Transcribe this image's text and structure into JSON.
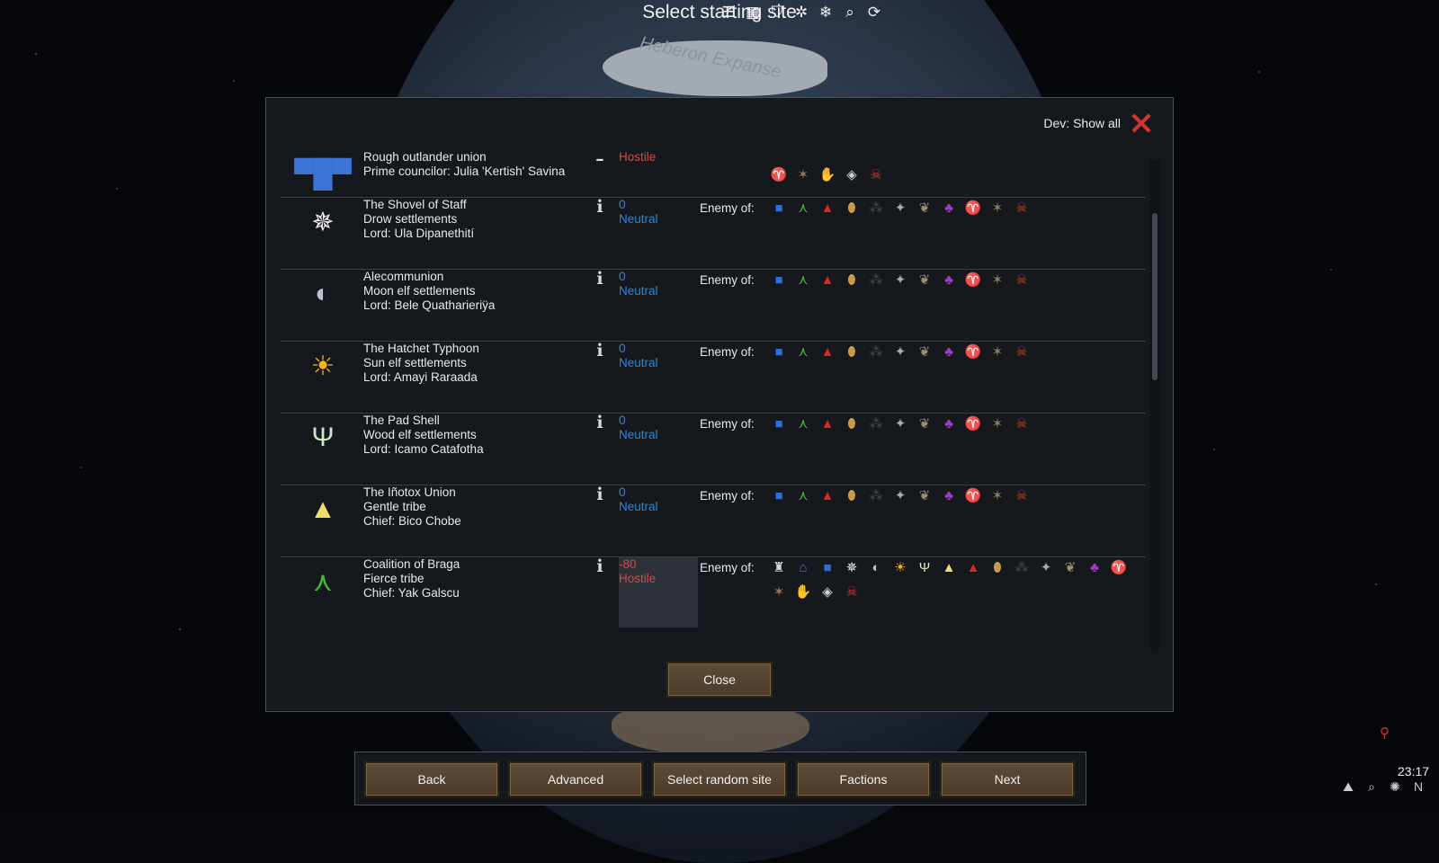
{
  "title": {
    "text": "Select starting site"
  },
  "top_icons": [
    {
      "name": "list-icon",
      "glyph": "☰"
    },
    {
      "name": "table-icon",
      "glyph": "▦"
    },
    {
      "name": "shield-icon",
      "glyph": "⛉"
    },
    {
      "name": "sparkle-icon",
      "glyph": "✲"
    },
    {
      "name": "snowflake-icon",
      "glyph": "❄"
    },
    {
      "name": "search-icon",
      "glyph": "⌕"
    },
    {
      "name": "refresh-icon",
      "glyph": "⟳"
    }
  ],
  "map": {
    "region_label": "Heberon Expanse"
  },
  "dialog": {
    "dev_label": "Dev: Show all",
    "close_label": "Close",
    "enemy_label": "Enemy of:",
    "factions": [
      {
        "name": "Rough outlander union",
        "type": "",
        "leader": "Prime councilor: Julia 'Kertish' Savina",
        "goodwill": "",
        "relation": "Hostile",
        "relation_kind": "hostile",
        "icon": {
          "glyph": "▀█▀",
          "color": "#3b73d6",
          "name": "outlander-union-icon"
        },
        "info": "–",
        "enemies": [
          {
            "glyph": "♈",
            "color": "#c8323a",
            "name": "demon-icon"
          },
          {
            "glyph": "✶",
            "color": "#8a7a5a",
            "name": "crossbones-icon"
          },
          {
            "glyph": "✋",
            "color": "#c97a30",
            "name": "claw-icon"
          },
          {
            "glyph": "◈",
            "color": "#cfcfcf",
            "name": "diamond-icon"
          },
          {
            "glyph": "☠",
            "color": "#d03a2e",
            "name": "pirate-icon"
          }
        ]
      },
      {
        "name": "The Shovel of Staff",
        "type": "Drow settlements",
        "leader": "Lord: Ula Dipanethití",
        "goodwill": "0",
        "relation": "Neutral",
        "relation_kind": "neutral",
        "icon": {
          "glyph": "✵",
          "color": "#f0f0f0",
          "name": "drow-star-icon"
        },
        "info": "i",
        "enemies": [
          {
            "glyph": "■",
            "color": "#2f6fd0",
            "name": "blue-banner-icon"
          },
          {
            "glyph": "⋏",
            "color": "#3fbf3a",
            "name": "green-tribe-icon"
          },
          {
            "glyph": "▲",
            "color": "#d52a22",
            "name": "red-tribe-icon"
          },
          {
            "glyph": "⬮",
            "color": "#c89a4a",
            "name": "beetle-icon"
          },
          {
            "glyph": "⁂",
            "color": "#4a4a4a",
            "name": "spider-icon"
          },
          {
            "glyph": "✦",
            "color": "#b0a89a",
            "name": "wings-icon"
          },
          {
            "glyph": "❦",
            "color": "#a08c6e",
            "name": "bull-icon"
          },
          {
            "glyph": "♣",
            "color": "#a33ad0",
            "name": "purple-faction-icon"
          },
          {
            "glyph": "♈",
            "color": "#c8323a",
            "name": "demon-icon"
          },
          {
            "glyph": "✶",
            "color": "#8a7a5a",
            "name": "crossbones-icon"
          },
          {
            "glyph": "☠",
            "color": "#d03a2e",
            "name": "pirate-icon"
          }
        ]
      },
      {
        "name": "Alecommunion",
        "type": "Moon elf settlements",
        "leader": "Lord: Bele Quatharieriÿa",
        "goodwill": "0",
        "relation": "Neutral",
        "relation_kind": "neutral",
        "icon": {
          "glyph": "◐",
          "color": "#b8c4cf",
          "name": "moon-icon"
        },
        "info": "i",
        "enemies": [
          {
            "glyph": "■",
            "color": "#2f6fd0",
            "name": "blue-banner-icon"
          },
          {
            "glyph": "⋏",
            "color": "#3fbf3a",
            "name": "green-tribe-icon"
          },
          {
            "glyph": "▲",
            "color": "#d52a22",
            "name": "red-tribe-icon"
          },
          {
            "glyph": "⬮",
            "color": "#c89a4a",
            "name": "beetle-icon"
          },
          {
            "glyph": "⁂",
            "color": "#4a4a4a",
            "name": "spider-icon"
          },
          {
            "glyph": "✦",
            "color": "#b0a89a",
            "name": "wings-icon"
          },
          {
            "glyph": "❦",
            "color": "#a08c6e",
            "name": "bull-icon"
          },
          {
            "glyph": "♣",
            "color": "#a33ad0",
            "name": "purple-faction-icon"
          },
          {
            "glyph": "♈",
            "color": "#c8323a",
            "name": "demon-icon"
          },
          {
            "glyph": "✶",
            "color": "#8a7a5a",
            "name": "crossbones-icon"
          },
          {
            "glyph": "☠",
            "color": "#d03a2e",
            "name": "pirate-icon"
          }
        ]
      },
      {
        "name": "The Hatchet Typhoon",
        "type": "Sun elf settlements",
        "leader": "Lord: Amayi Raraada",
        "goodwill": "0",
        "relation": "Neutral",
        "relation_kind": "neutral",
        "icon": {
          "glyph": "☀",
          "color": "#f5b321",
          "name": "sun-icon"
        },
        "info": "i",
        "enemies": [
          {
            "glyph": "■",
            "color": "#2f6fd0",
            "name": "blue-banner-icon"
          },
          {
            "glyph": "⋏",
            "color": "#3fbf3a",
            "name": "green-tribe-icon"
          },
          {
            "glyph": "▲",
            "color": "#d52a22",
            "name": "red-tribe-icon"
          },
          {
            "glyph": "⬮",
            "color": "#c89a4a",
            "name": "beetle-icon"
          },
          {
            "glyph": "⁂",
            "color": "#4a4a4a",
            "name": "spider-icon"
          },
          {
            "glyph": "✦",
            "color": "#b0a89a",
            "name": "wings-icon"
          },
          {
            "glyph": "❦",
            "color": "#a08c6e",
            "name": "bull-icon"
          },
          {
            "glyph": "♣",
            "color": "#a33ad0",
            "name": "purple-faction-icon"
          },
          {
            "glyph": "♈",
            "color": "#c8323a",
            "name": "demon-icon"
          },
          {
            "glyph": "✶",
            "color": "#8a7a5a",
            "name": "crossbones-icon"
          },
          {
            "glyph": "☠",
            "color": "#d03a2e",
            "name": "pirate-icon"
          }
        ]
      },
      {
        "name": "The Pad Shell",
        "type": "Wood elf settlements",
        "leader": "Lord: Icamo Catafotha",
        "goodwill": "0",
        "relation": "Neutral",
        "relation_kind": "neutral",
        "icon": {
          "glyph": "Ψ",
          "color": "#cfe8c8",
          "name": "antlers-icon"
        },
        "info": "i",
        "enemies": [
          {
            "glyph": "■",
            "color": "#2f6fd0",
            "name": "blue-banner-icon"
          },
          {
            "glyph": "⋏",
            "color": "#3fbf3a",
            "name": "green-tribe-icon"
          },
          {
            "glyph": "▲",
            "color": "#d52a22",
            "name": "red-tribe-icon"
          },
          {
            "glyph": "⬮",
            "color": "#c89a4a",
            "name": "beetle-icon"
          },
          {
            "glyph": "⁂",
            "color": "#4a4a4a",
            "name": "spider-icon"
          },
          {
            "glyph": "✦",
            "color": "#b0a89a",
            "name": "wings-icon"
          },
          {
            "glyph": "❦",
            "color": "#a08c6e",
            "name": "bull-icon"
          },
          {
            "glyph": "♣",
            "color": "#a33ad0",
            "name": "purple-faction-icon"
          },
          {
            "glyph": "♈",
            "color": "#c8323a",
            "name": "demon-icon"
          },
          {
            "glyph": "✶",
            "color": "#8a7a5a",
            "name": "crossbones-icon"
          },
          {
            "glyph": "☠",
            "color": "#d03a2e",
            "name": "pirate-icon"
          }
        ]
      },
      {
        "name": "The Iñotox Union",
        "type": "Gentle tribe",
        "leader": "Chief: Bico Chobe",
        "goodwill": "0",
        "relation": "Neutral",
        "relation_kind": "neutral",
        "icon": {
          "glyph": "▲",
          "color": "#f0e06a",
          "name": "yellow-tribe-icon"
        },
        "info": "i",
        "enemies": [
          {
            "glyph": "■",
            "color": "#2f6fd0",
            "name": "blue-banner-icon"
          },
          {
            "glyph": "⋏",
            "color": "#3fbf3a",
            "name": "green-tribe-icon"
          },
          {
            "glyph": "▲",
            "color": "#d52a22",
            "name": "red-tribe-icon"
          },
          {
            "glyph": "⬮",
            "color": "#c89a4a",
            "name": "beetle-icon"
          },
          {
            "glyph": "⁂",
            "color": "#4a4a4a",
            "name": "spider-icon"
          },
          {
            "glyph": "✦",
            "color": "#b0a89a",
            "name": "wings-icon"
          },
          {
            "glyph": "❦",
            "color": "#a08c6e",
            "name": "bull-icon"
          },
          {
            "glyph": "♣",
            "color": "#a33ad0",
            "name": "purple-faction-icon"
          },
          {
            "glyph": "♈",
            "color": "#c8323a",
            "name": "demon-icon"
          },
          {
            "glyph": "✶",
            "color": "#8a7a5a",
            "name": "crossbones-icon"
          },
          {
            "glyph": "☠",
            "color": "#d03a2e",
            "name": "pirate-icon"
          }
        ]
      },
      {
        "name": "Coalition of Braga",
        "type": "Fierce tribe",
        "leader": "Chief: Yak Galscu",
        "goodwill": "-80",
        "relation": "Hostile",
        "relation_kind": "hostile",
        "icon": {
          "glyph": "⋏",
          "color": "#3fbf3a",
          "name": "green-tribe-icon"
        },
        "info": "i",
        "enemies": [
          {
            "glyph": "♜",
            "color": "#d8d8d8",
            "name": "empire-icon"
          },
          {
            "glyph": "⌂",
            "color": "#6a6ad0",
            "name": "house-icon"
          },
          {
            "glyph": "■",
            "color": "#2f6fd0",
            "name": "blue-banner-icon"
          },
          {
            "glyph": "✵",
            "color": "#f0f0f0",
            "name": "drow-star-icon"
          },
          {
            "glyph": "◐",
            "color": "#b8c4cf",
            "name": "moon-icon"
          },
          {
            "glyph": "☀",
            "color": "#f5b321",
            "name": "sun-icon"
          },
          {
            "glyph": "Ψ",
            "color": "#cfe8c8",
            "name": "antlers-icon"
          },
          {
            "glyph": "▲",
            "color": "#f0e06a",
            "name": "yellow-tribe-icon"
          },
          {
            "glyph": "▲",
            "color": "#d52a22",
            "name": "red-tribe-icon"
          },
          {
            "glyph": "⬮",
            "color": "#c89a4a",
            "name": "beetle-icon"
          },
          {
            "glyph": "⁂",
            "color": "#4a4a4a",
            "name": "spider-icon"
          },
          {
            "glyph": "✦",
            "color": "#b0a89a",
            "name": "wings-icon"
          },
          {
            "glyph": "❦",
            "color": "#a08c6e",
            "name": "bull-icon"
          },
          {
            "glyph": "♣",
            "color": "#a33ad0",
            "name": "purple-faction-icon"
          },
          {
            "glyph": "♈",
            "color": "#c8323a",
            "name": "demon-icon"
          },
          {
            "glyph": "✶",
            "color": "#8a7a5a",
            "name": "crossbones-icon"
          },
          {
            "glyph": "✋",
            "color": "#c97a30",
            "name": "claw-icon"
          },
          {
            "glyph": "◈",
            "color": "#cfcfcf",
            "name": "diamond-icon"
          },
          {
            "glyph": "☠",
            "color": "#d03a2e",
            "name": "pirate-icon"
          }
        ]
      }
    ]
  },
  "bottom_bar": {
    "back": "Back",
    "advanced": "Advanced",
    "random_site": "Select random site",
    "factions": "Factions",
    "next": "Next"
  },
  "status": {
    "time": "23:17"
  },
  "map_tools": [
    {
      "name": "mountain-icon",
      "glyph": "⛰"
    },
    {
      "name": "magnifier-icon",
      "glyph": "⌕"
    },
    {
      "name": "bulb-icon",
      "glyph": "✺"
    },
    {
      "name": "north-arrow-icon",
      "glyph": "N"
    }
  ],
  "colors": {
    "neutral": "#2f86d7",
    "hostile": "#d54a44",
    "button_bg": "#5e4c36",
    "close_x": "#d3352b"
  }
}
